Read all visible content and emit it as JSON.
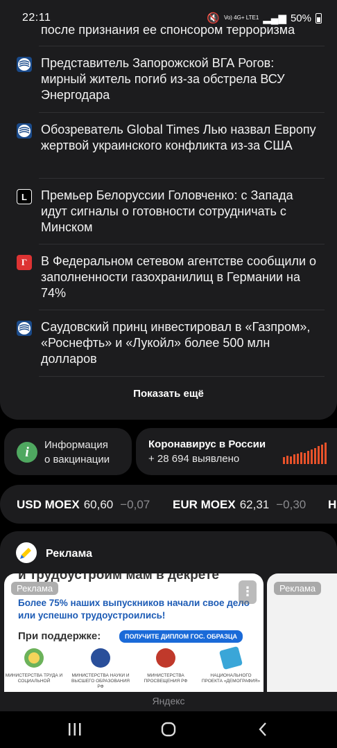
{
  "status_bar": {
    "time": "22:11",
    "network": "Vo) 4G+ LTE1",
    "battery": "50%"
  },
  "news": {
    "partial_title": "после признания ее спонсором терроризма",
    "items": [
      {
        "source_icon": "ria-icon",
        "title": "Представитель Запорожской ВГА Рогов: мирный житель погиб из-за обстрела ВСУ Энергодара"
      },
      {
        "source_icon": "ria-icon",
        "title": "Обозреватель Global Times Лью назвал Европу жертвой украинского конфликта из-за США"
      },
      {
        "source_icon": "lenta-icon",
        "letter": "L",
        "title": "Премьер Белоруссии Головченко: с Запада идут сигналы о готовности сотрудничать с Минском"
      },
      {
        "source_icon": "gazeta-icon",
        "letter": "Г",
        "title": "В Федеральном сетевом агентстве сообщили о заполненности газохранилищ в Германии на 74%"
      },
      {
        "source_icon": "ria-icon",
        "title": "Саудовский принц инвестировал в «Газпром», «Роснефть» и «Лукойл» более 500 млн долларов"
      }
    ],
    "show_more": "Показать ещё"
  },
  "info": {
    "vaccination": {
      "icon_letter": "i",
      "line1": "Информация",
      "line2": "о вакцинации"
    },
    "covid": {
      "title": "Коронавирус в России",
      "subtitle": "+ 28 694 выявлено"
    }
  },
  "currency": [
    {
      "name": "USD MOEX",
      "value": "60,60",
      "change": "−0,07"
    },
    {
      "name": "EUR MOEX",
      "value": "62,31",
      "change": "−0,30"
    },
    {
      "name": "H",
      "value": "",
      "change": ""
    }
  ],
  "ad": {
    "title": "Реклама",
    "badge": "Реклама",
    "badge2": "Реклама",
    "menu": "⋮",
    "headline": "и трудоустроим мам в декрете",
    "blue_text": "Более 75% наших выпускников начали свое дело или успешно трудоустроились!",
    "support_label": "При поддержке:",
    "diploma_label": "ПОЛУЧИТЕ ДИПЛОМ ГОС. ОБРАЗЦА",
    "partners": [
      {
        "label": "Министерства труда и социальной",
        "color": "#e8b83a"
      },
      {
        "label": "Министерства науки и высшего образования РФ",
        "color": "#2a4f9a"
      },
      {
        "label": "Министерства просвещения РФ",
        "color": "#c0392b"
      },
      {
        "label": "Национального проекта «Демография»",
        "color": "#3aa6d8"
      }
    ]
  },
  "footer": {
    "yandex": "Яндекс"
  },
  "colors": {
    "background": "#000000",
    "card": "#1c1c1e",
    "muted": "#8a8a8e",
    "accent_green": "#4fa860",
    "covid_bars": "#e8522a"
  }
}
